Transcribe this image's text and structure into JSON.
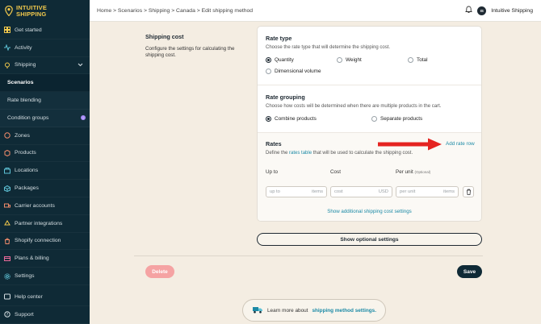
{
  "app": {
    "brand_line1": "INTUITIVE",
    "brand_line2": "SHIPPING",
    "account_initials": "IS",
    "account_name": "Intuitive Shipping"
  },
  "breadcrumb": "Home > Scenarios > Shipping > Canada > Edit shipping method",
  "sidebar": {
    "items": [
      {
        "label": "Get started",
        "icon": "dashboard-icon"
      },
      {
        "label": "Activity",
        "icon": "activity-icon"
      },
      {
        "label": "Shipping",
        "icon": "shipping-icon"
      },
      {
        "label": "Scenarios",
        "icon": ""
      },
      {
        "label": "Rate blending",
        "icon": ""
      },
      {
        "label": "Condition groups",
        "icon": ""
      },
      {
        "label": "Zones",
        "icon": "zones-icon"
      },
      {
        "label": "Products",
        "icon": "products-icon"
      },
      {
        "label": "Locations",
        "icon": "locations-icon"
      },
      {
        "label": "Packages",
        "icon": "packages-icon"
      },
      {
        "label": "Carrier accounts",
        "icon": "carrier-icon"
      },
      {
        "label": "Partner integrations",
        "icon": "partner-icon"
      },
      {
        "label": "Shopify connection",
        "icon": "shopify-icon"
      },
      {
        "label": "Plans & billing",
        "icon": "billing-icon"
      },
      {
        "label": "Settings",
        "icon": "settings-icon"
      }
    ],
    "bottom": [
      {
        "label": "Help center"
      },
      {
        "label": "Support"
      }
    ]
  },
  "section": {
    "title": "Shipping cost",
    "description": "Configure the settings for calculating the shipping cost."
  },
  "rate_type": {
    "title": "Rate type",
    "description": "Choose the rate type that will determine the shipping cost.",
    "options": [
      "Quantity",
      "Weight",
      "Total",
      "Dimensional volume"
    ],
    "selected": "Quantity"
  },
  "rate_grouping": {
    "title": "Rate grouping",
    "description": "Choose how costs will be determined when there are multiple products in the cart.",
    "options": [
      "Combine products",
      "Separate products"
    ],
    "selected": "Combine products"
  },
  "rates": {
    "title": "Rates",
    "desc_prefix": "Define the",
    "desc_link": "rates table",
    "desc_suffix": "that will be used to calculate the shipping cost.",
    "add_row": "Add rate row",
    "columns": {
      "up_to": "Up to",
      "cost": "Cost",
      "per_unit": "Per unit",
      "optional": "(Optional)"
    },
    "row": {
      "up_to_placeholder": "up to",
      "up_to_unit": "items",
      "cost_placeholder": "cost",
      "cost_unit": "USD",
      "per_unit_placeholder": "per unit",
      "per_unit_unit": "items"
    },
    "show_additional": "Show additional shipping cost settings"
  },
  "buttons": {
    "optional_settings": "Show optional settings",
    "delete": "Delete",
    "save": "Save"
  },
  "learn": {
    "prefix": "Learn more about",
    "link": "shipping method settings."
  },
  "colors": {
    "sidebar": "#0f2a36",
    "accent": "#1c8aa6",
    "background": "#f4ede2",
    "arrow": "#e52421"
  }
}
